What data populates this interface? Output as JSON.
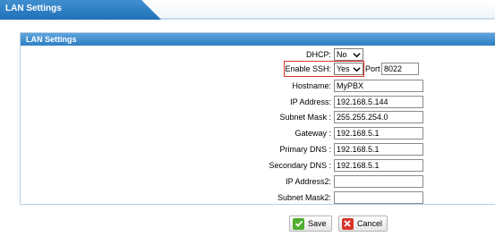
{
  "tab": {
    "title": "LAN Settings"
  },
  "panel": {
    "title": "LAN Settings"
  },
  "form": {
    "dhcp": {
      "label": "DHCP:",
      "value": "No"
    },
    "ssh": {
      "label": "Enable SSH:",
      "value": "Yes",
      "port_label": "Port",
      "port_value": "8022"
    },
    "hostname": {
      "label": "Hostname:",
      "value": "MyPBX"
    },
    "ip": {
      "label": "IP Address:",
      "value": "192.168.5.144"
    },
    "mask": {
      "label": "Subnet Mask :",
      "value": "255.255.254.0"
    },
    "gateway": {
      "label": "Gateway :",
      "value": "192.168.5.1"
    },
    "dns1": {
      "label": "Primary DNS :",
      "value": "192.168.5.1"
    },
    "dns2": {
      "label": "Secondary DNS :",
      "value": "192.168.5.1"
    },
    "ip2": {
      "label": "IP Address2:",
      "value": ""
    },
    "mask2": {
      "label": "Subnet Mask2:",
      "value": ""
    }
  },
  "buttons": {
    "save": "Save",
    "cancel": "Cancel"
  },
  "icons": {
    "save": "check-icon",
    "cancel": "x-icon",
    "dropdown": "chevron-down-icon"
  },
  "colors": {
    "tab_blue": "#2171b7",
    "highlight_red": "#e1312f",
    "save_green": "#4fae2e",
    "cancel_red": "#d9342b"
  }
}
